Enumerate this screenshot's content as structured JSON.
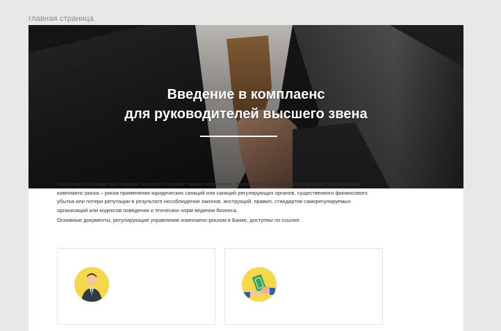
{
  "breadcrumb": {
    "label": "главная страница"
  },
  "hero": {
    "title_line1": "Введение в комплаенс",
    "title_line2": "для руководителей высшего звена"
  },
  "intro": {
    "paragraph1": "Настоящее руководство содержит краткое описание правил комплаенс. Нарушение правил комплаенс ведет к реализации комплаенс-риска – риска применения юридических санкций или санкций регулирующих органов, существенного финансового убытка или потери репутации в результате несоблюдения законов, инструкций, правил, стандартов саморегулируемых организаций или кодексов поведения и этических норм ведения бизнеса.",
    "paragraph2": "Основные документы, регулирующие управление комплаенс-риском в Банке, доступны по ссылке."
  },
  "cards": [
    {
      "icon": "businessman-icon"
    },
    {
      "icon": "money-handshake-icon"
    }
  ],
  "colors": {
    "page_bg": "#e8e8e8",
    "icon_circle": "#f5d94a",
    "hero_text": "#ffffff"
  }
}
